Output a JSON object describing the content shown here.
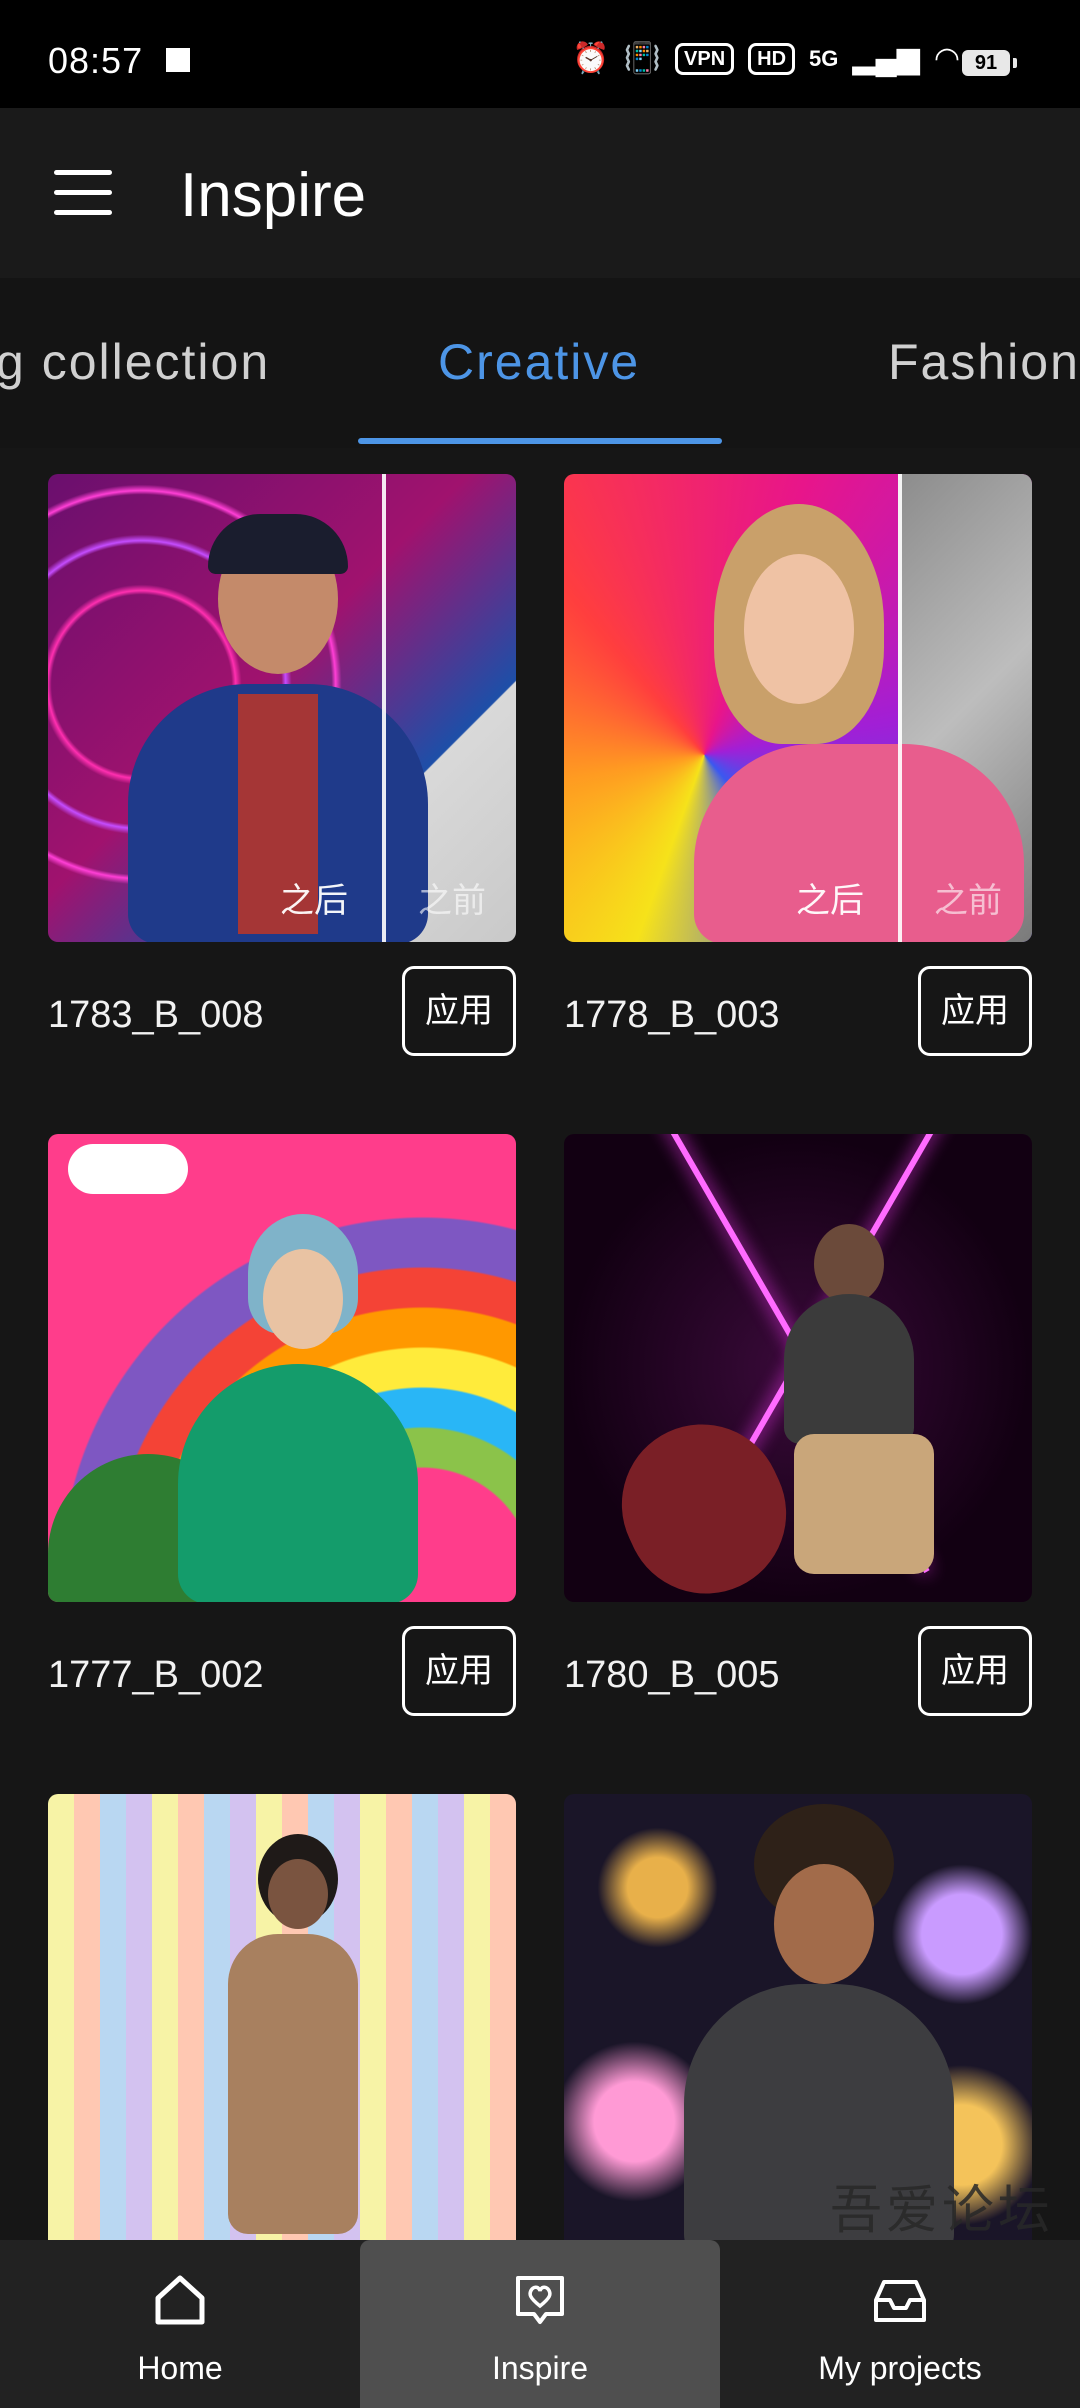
{
  "status": {
    "time": "08:57",
    "vpn": "VPN",
    "hd": "HD",
    "network": "5G",
    "battery": "91"
  },
  "header": {
    "title": "Inspire"
  },
  "tabs": [
    {
      "label": "g collection"
    },
    {
      "label": "Creative"
    },
    {
      "label": "Fashion"
    }
  ],
  "active_tab": "Creative",
  "cards": [
    {
      "name": "1783_B_008",
      "apply": "应用",
      "after": "之后",
      "before": "之前"
    },
    {
      "name": "1778_B_003",
      "apply": "应用",
      "after": "之后",
      "before": "之前"
    },
    {
      "name": "1777_B_002",
      "apply": "应用"
    },
    {
      "name": "1780_B_005",
      "apply": "应用"
    },
    {
      "name": "",
      "apply": ""
    },
    {
      "name": "",
      "apply": ""
    }
  ],
  "nav": [
    {
      "label": "Home",
      "icon": "home-icon"
    },
    {
      "label": "Inspire",
      "icon": "heart-chat-icon"
    },
    {
      "label": "My projects",
      "icon": "inbox-icon"
    }
  ],
  "watermark": "吾爱论坛"
}
